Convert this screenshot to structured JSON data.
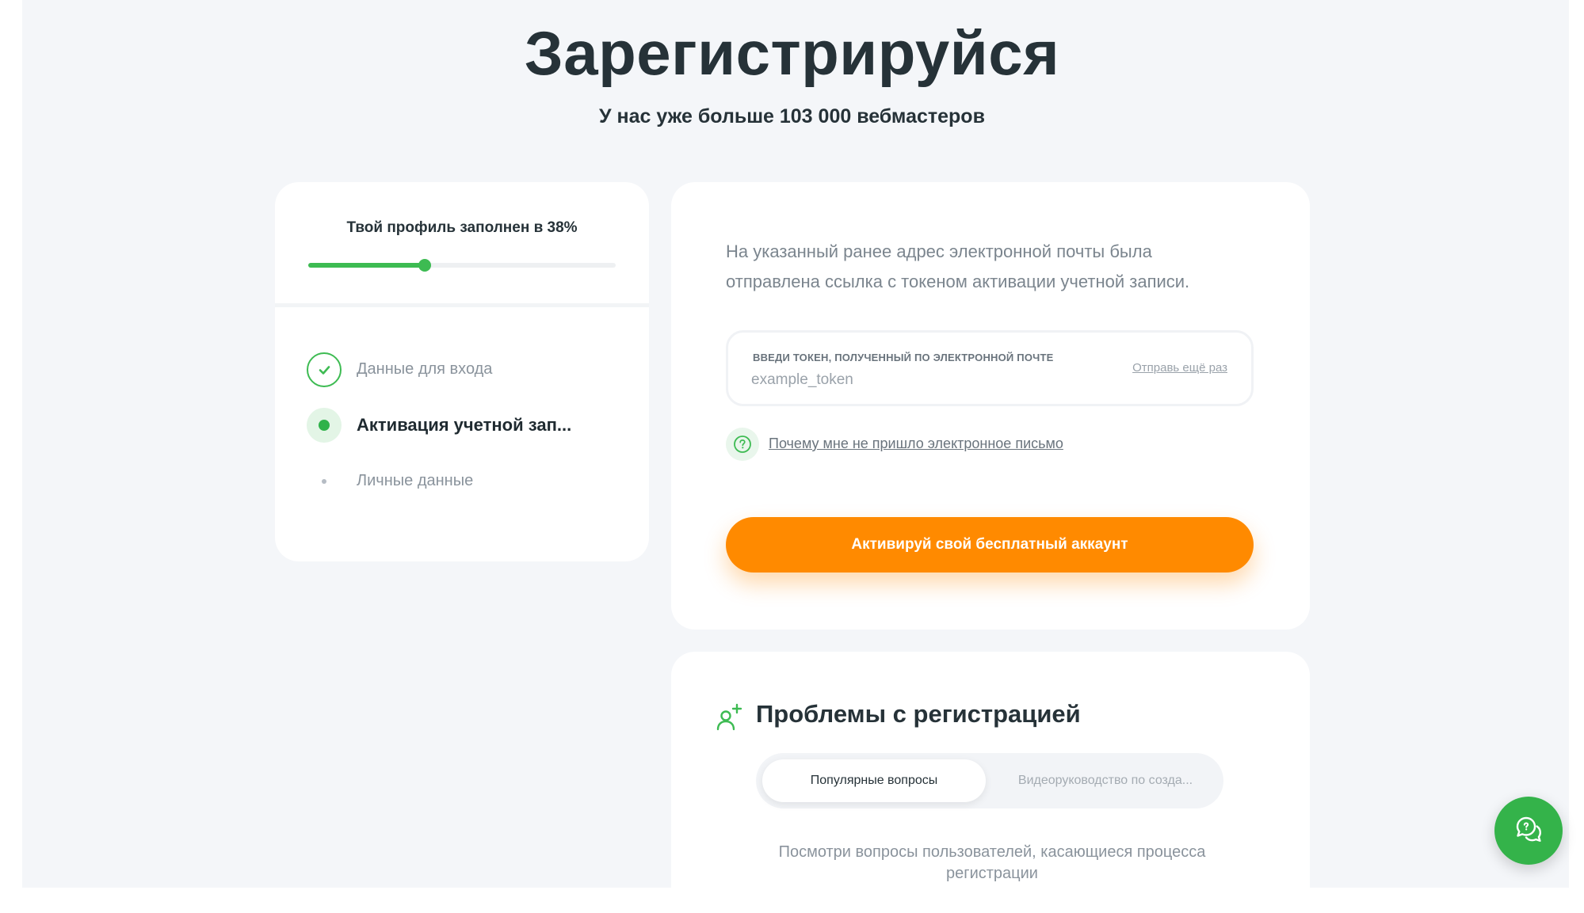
{
  "header": {
    "title": "Зарегистрируйся",
    "subtitle": "У нас уже больше 103 000 вебмастеров"
  },
  "profile": {
    "progress_label": "Твой профиль заполнен в 38%",
    "progress_percent": 38,
    "progress_color": "#3dbb52"
  },
  "steps": [
    {
      "label": "Данные для входа",
      "state": "done",
      "icon": "check-icon"
    },
    {
      "label": "Активация учетной зап...",
      "state": "active",
      "icon": "active-dot-icon"
    },
    {
      "label": "Личные данные",
      "state": "pending",
      "icon": "pending-dot-icon"
    }
  ],
  "activation": {
    "info_text": "На указанный ранее адрес электронной почты была отправлена ссылка с токеном активации учетной записи.",
    "token_label": "Введи токен, полученный по электронной почте",
    "token_placeholder": "example_token",
    "resend_link": "Отправь ещё раз",
    "why_link": "Почему мне не пришло электронное письмо",
    "why_icon": "question-icon",
    "submit_label": "Активируй свой бесплатный аккаунт",
    "accent_color": "#ff8a00"
  },
  "problems": {
    "icon": "add-user-icon",
    "title": "Проблемы с регистрацией",
    "tabs": [
      {
        "label": "Популярные вопросы",
        "active": true
      },
      {
        "label": "Видеоруководство по созда...",
        "active": false
      }
    ],
    "description": "Посмотри вопросы пользователей, касающиеся процесса регистрации"
  },
  "chat": {
    "icon": "chat-icon"
  }
}
